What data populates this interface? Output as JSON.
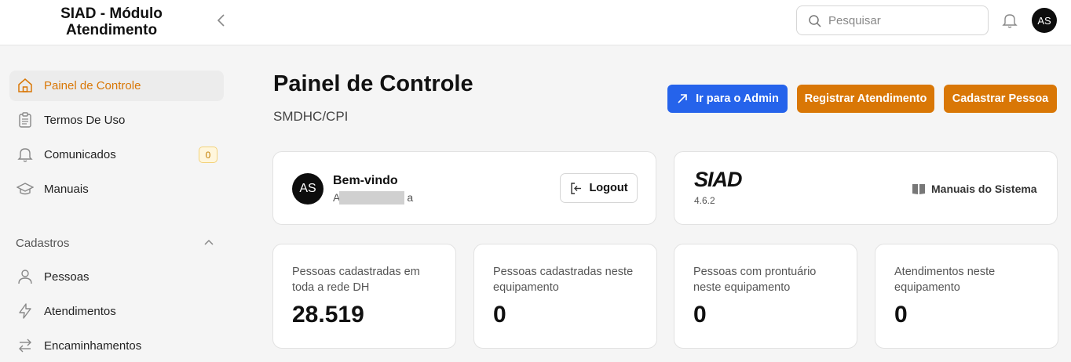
{
  "app": {
    "title": "SIAD - Módulo Atendimento"
  },
  "topbar": {
    "search_placeholder": "Pesquisar",
    "avatar_initials": "AS"
  },
  "sidebar": {
    "items": [
      {
        "label": "Painel de Controle",
        "icon": "home-icon",
        "active": true
      },
      {
        "label": "Termos De Uso",
        "icon": "clipboard-icon"
      },
      {
        "label": "Comunicados",
        "icon": "bell-icon",
        "badge": "0"
      },
      {
        "label": "Manuais",
        "icon": "graduation-cap-icon"
      }
    ],
    "section": {
      "label": "Cadastros",
      "items": [
        {
          "label": "Pessoas",
          "icon": "user-icon"
        },
        {
          "label": "Atendimentos",
          "icon": "lightning-icon"
        },
        {
          "label": "Encaminhamentos",
          "icon": "arrows-left-right-icon"
        }
      ]
    }
  },
  "main": {
    "title": "Painel de Controle",
    "subtitle": "SMDHC/CPI",
    "actions": {
      "admin": "Ir para o Admin",
      "registrar": "Registrar Atendimento",
      "cadastrar": "Cadastrar Pessoa"
    },
    "welcome": {
      "avatar": "AS",
      "title": "Bem-vindo",
      "name_start": "A",
      "name_end": "a",
      "logout": "Logout"
    },
    "version": {
      "logo": "SIAD",
      "version": "4.6.2",
      "manuais_link": "Manuais do Sistema"
    },
    "stats": [
      {
        "label": "Pessoas cadastradas em toda a rede DH",
        "value": "28.519"
      },
      {
        "label": "Pessoas cadastradas neste equipamento",
        "value": "0"
      },
      {
        "label": "Pessoas com prontuário neste equipamento",
        "value": "0"
      },
      {
        "label": "Atendimentos neste equipamento",
        "value": "0"
      }
    ]
  },
  "colors": {
    "accent": "#d97706",
    "primary_blue": "#2563eb",
    "badge_bg": "#fff6dc"
  }
}
